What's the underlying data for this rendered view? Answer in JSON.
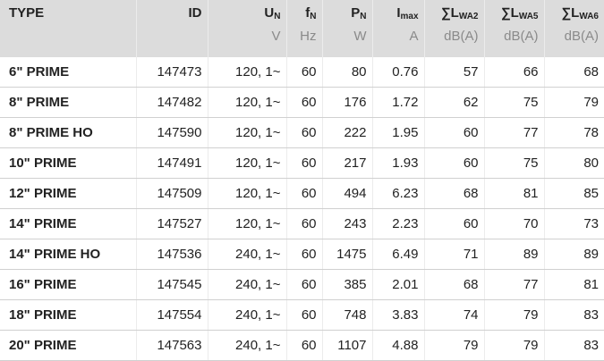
{
  "table": {
    "headers": [
      {
        "key": "type",
        "symbol": "TYPE",
        "sub": "",
        "unit": ""
      },
      {
        "key": "id",
        "symbol": "ID",
        "sub": "",
        "unit": ""
      },
      {
        "key": "un",
        "symbol": "U",
        "sub": "N",
        "unit": "V"
      },
      {
        "key": "fn",
        "symbol": "f",
        "sub": "N",
        "unit": "Hz"
      },
      {
        "key": "pn",
        "symbol": "P",
        "sub": "N",
        "unit": "W"
      },
      {
        "key": "imax",
        "symbol": "I",
        "sub": "max",
        "unit": "A"
      },
      {
        "key": "lwa2",
        "symbol": "∑L",
        "sub": "WA2",
        "unit": "dB(A)"
      },
      {
        "key": "lwa5",
        "symbol": "∑L",
        "sub": "WA5",
        "unit": "dB(A)"
      },
      {
        "key": "lwa6",
        "symbol": "∑L",
        "sub": "WA6",
        "unit": "dB(A)"
      }
    ],
    "rows": [
      {
        "type": "6\" PRIME",
        "id": "147473",
        "un": "120, 1~",
        "fn": "60",
        "pn": "80",
        "imax": "0.76",
        "lwa2": "57",
        "lwa5": "66",
        "lwa6": "68"
      },
      {
        "type": "8\" PRIME",
        "id": "147482",
        "un": "120, 1~",
        "fn": "60",
        "pn": "176",
        "imax": "1.72",
        "lwa2": "62",
        "lwa5": "75",
        "lwa6": "79"
      },
      {
        "type": "8\" PRIME HO",
        "id": "147590",
        "un": "120, 1~",
        "fn": "60",
        "pn": "222",
        "imax": "1.95",
        "lwa2": "60",
        "lwa5": "77",
        "lwa6": "78"
      },
      {
        "type": "10\" PRIME",
        "id": "147491",
        "un": "120, 1~",
        "fn": "60",
        "pn": "217",
        "imax": "1.93",
        "lwa2": "60",
        "lwa5": "75",
        "lwa6": "80"
      },
      {
        "type": "12\" PRIME",
        "id": "147509",
        "un": "120, 1~",
        "fn": "60",
        "pn": "494",
        "imax": "6.23",
        "lwa2": "68",
        "lwa5": "81",
        "lwa6": "85"
      },
      {
        "type": "14\" PRIME",
        "id": "147527",
        "un": "120, 1~",
        "fn": "60",
        "pn": "243",
        "imax": "2.23",
        "lwa2": "60",
        "lwa5": "70",
        "lwa6": "73"
      },
      {
        "type": "14\" PRIME HO",
        "id": "147536",
        "un": "240, 1~",
        "fn": "60",
        "pn": "1475",
        "imax": "6.49",
        "lwa2": "71",
        "lwa5": "89",
        "lwa6": "89"
      },
      {
        "type": "16\" PRIME",
        "id": "147545",
        "un": "240, 1~",
        "fn": "60",
        "pn": "385",
        "imax": "2.01",
        "lwa2": "68",
        "lwa5": "77",
        "lwa6": "81"
      },
      {
        "type": "18\" PRIME",
        "id": "147554",
        "un": "240, 1~",
        "fn": "60",
        "pn": "748",
        "imax": "3.83",
        "lwa2": "74",
        "lwa5": "79",
        "lwa6": "83"
      },
      {
        "type": "20\" PRIME",
        "id": "147563",
        "un": "240, 1~",
        "fn": "60",
        "pn": "1107",
        "imax": "4.88",
        "lwa2": "79",
        "lwa5": "79",
        "lwa6": "83"
      }
    ]
  },
  "colors": {
    "header_bg": "#dcdcdc",
    "unit_text": "#8a8a8a",
    "row_border": "#d0d0d0"
  }
}
